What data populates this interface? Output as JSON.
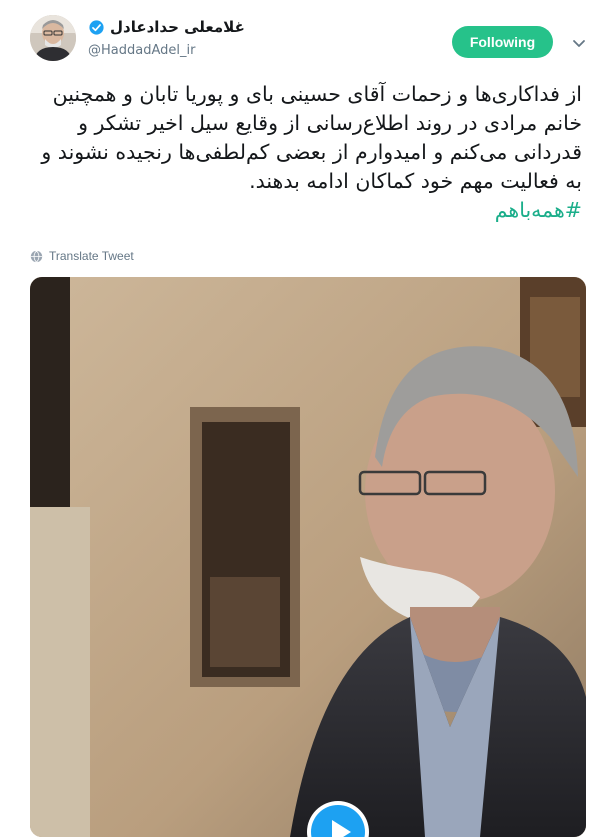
{
  "user": {
    "display_name": "غلامعلی حدادعادل",
    "handle": "@HaddadAdel_ir",
    "avatar_icon": "avatar-portrait",
    "verified_icon": "verified-badge-icon"
  },
  "actions": {
    "follow_label": "Following",
    "menu_icon": "chevron-down-icon"
  },
  "tweet": {
    "text": "از فداکاری‌ها و زحمات آقای حسینی بای و پوریا تابان و همچنین خانم مرادی در روند اطلاع‌رسانی از وقایع سیل اخیر تشکر و قدردانی می‌کنم و امیدوارم از بعضی کم‌لطفی‌ها رنجیده نشوند و به فعالیت مهم خود کماکان ادامه بدهند.",
    "hashtag": "#همه‌باهم",
    "translate_label": "Translate Tweet"
  },
  "media": {
    "type": "video",
    "play_icon": "play-button-icon"
  },
  "colors": {
    "follow_bg": "#26c28a",
    "hashtag": "#1aae8a",
    "verified": "#1da1f2",
    "text": "#14171a",
    "muted": "#657786"
  }
}
